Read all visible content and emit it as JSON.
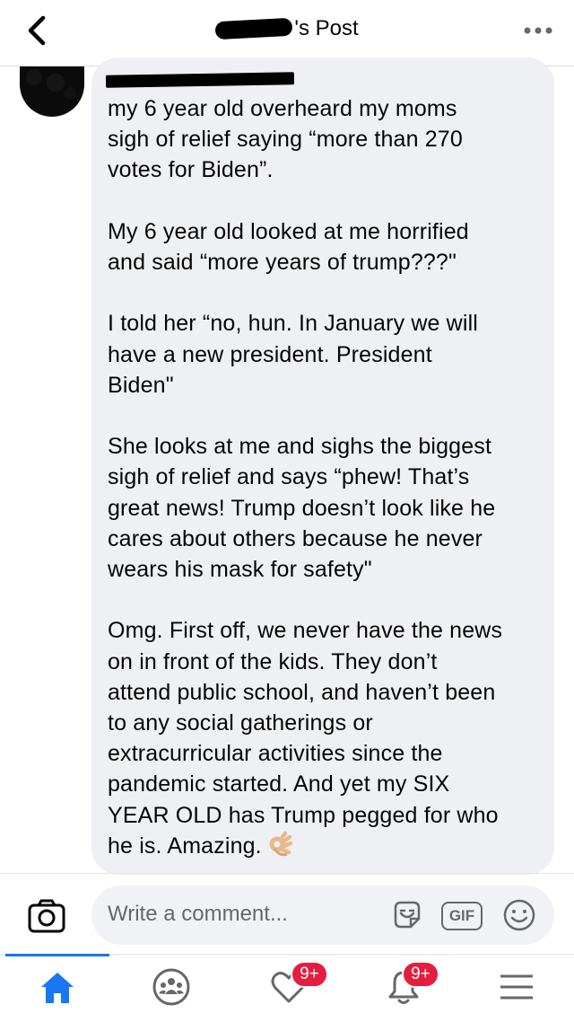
{
  "header": {
    "title_suffix": "'s Post",
    "back_icon": "chevron-left-icon",
    "more_icon": "more-dots-icon"
  },
  "comment": {
    "text": "my 6 year old overheard my moms\nsigh of relief saying “more than 270\nvotes for Biden”.\n\nMy 6 year old looked at me horrified\nand said “more years of trump???\"\n\nI told her “no, hun. In January we will\nhave a new president. President\nBiden\"\n\nShe looks at me and sighs the biggest\nsigh of relief and says “phew! That’s\ngreat news! Trump doesn’t look like he\ncares about others because he never\nwears his mask for safety\"\n\nOmg. First off, we never have the news\non in front of the kids. They don’t\nattend public school, and haven’t been\nto any social gatherings or\nextracurricular activities since the\npandemic started. And yet my SIX\nYEAR OLD has Trump pegged for who\nhe is. Amazing.",
    "emoji": "ok-hand-emoji"
  },
  "composer": {
    "placeholder": "Write a comment...",
    "gif_label": "GIF",
    "camera_icon": "camera-icon",
    "sticker_icon": "sticker-icon",
    "emoji_icon": "smiley-icon"
  },
  "nav": {
    "items": [
      {
        "name": "home",
        "icon": "home-icon",
        "active": true
      },
      {
        "name": "groups",
        "icon": "groups-icon"
      },
      {
        "name": "dating",
        "icon": "heart-icon",
        "badge": "9+"
      },
      {
        "name": "notifications",
        "icon": "bell-icon",
        "badge": "9+"
      },
      {
        "name": "menu",
        "icon": "hamburger-menu-icon"
      }
    ]
  },
  "colors": {
    "accent": "#1877f2",
    "badge": "#e41e3f",
    "bubble": "#eff0f3",
    "muted": "#65676b"
  }
}
